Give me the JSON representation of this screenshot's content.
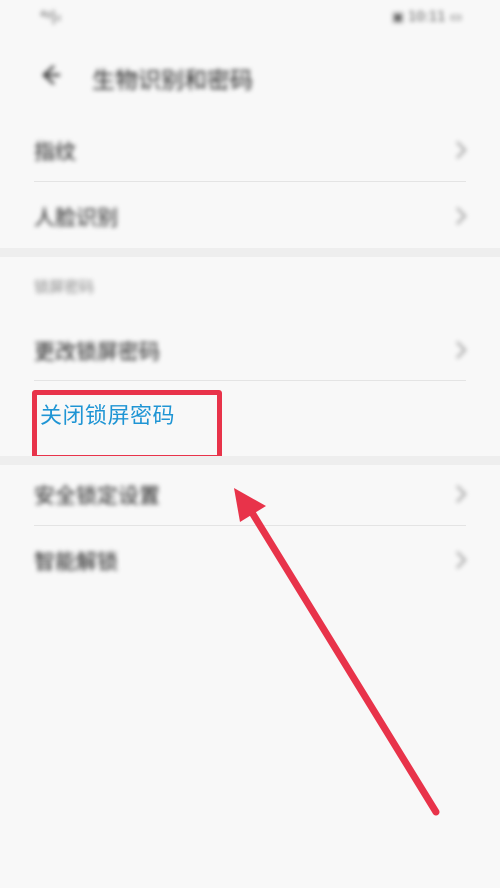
{
  "status_bar": {
    "left_text": "⁴ᵍ|ᵢₗ",
    "right_text": "▣ 10:11 ▭"
  },
  "header": {
    "title": "生物识别和密码"
  },
  "rows": {
    "fingerprint": "指纹",
    "face": "人脸识别",
    "section_title": "锁屏密码",
    "change_lock": "更改锁屏密码",
    "close_lock": "关闭锁屏密码",
    "security_lock": "安全锁定设置",
    "smart_unlock": "智能解锁"
  },
  "annotation": {
    "box_color": "#e8334a",
    "arrow_color": "#e8334a",
    "highlight_color": "#1f95d4"
  }
}
